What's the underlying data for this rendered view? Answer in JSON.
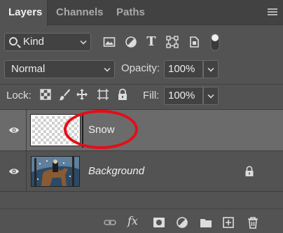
{
  "tabs": [
    {
      "label": "Layers",
      "active": true
    },
    {
      "label": "Channels",
      "active": false
    },
    {
      "label": "Paths",
      "active": false
    }
  ],
  "filter": {
    "kind_value": "Kind"
  },
  "blend": {
    "mode_value": "Normal"
  },
  "opacity": {
    "label": "Opacity:",
    "value": "100%"
  },
  "lock": {
    "label": "Lock:"
  },
  "fill": {
    "label": "Fill:",
    "value": "100%"
  },
  "layers": [
    {
      "name": "Snow",
      "selected": true,
      "visible": true,
      "locked": false
    },
    {
      "name": "Background",
      "selected": false,
      "visible": true,
      "locked": true
    }
  ],
  "colors": {
    "panel_bg": "#535353",
    "tab_bar": "#424242",
    "selected_row": "#6b6b6b",
    "annotation": "#e50d17"
  },
  "icons": {
    "footer": [
      "link-layers-icon",
      "fx-icon",
      "add-mask-icon",
      "adjustment-layer-icon",
      "new-group-icon",
      "new-layer-icon",
      "trash-icon"
    ]
  }
}
